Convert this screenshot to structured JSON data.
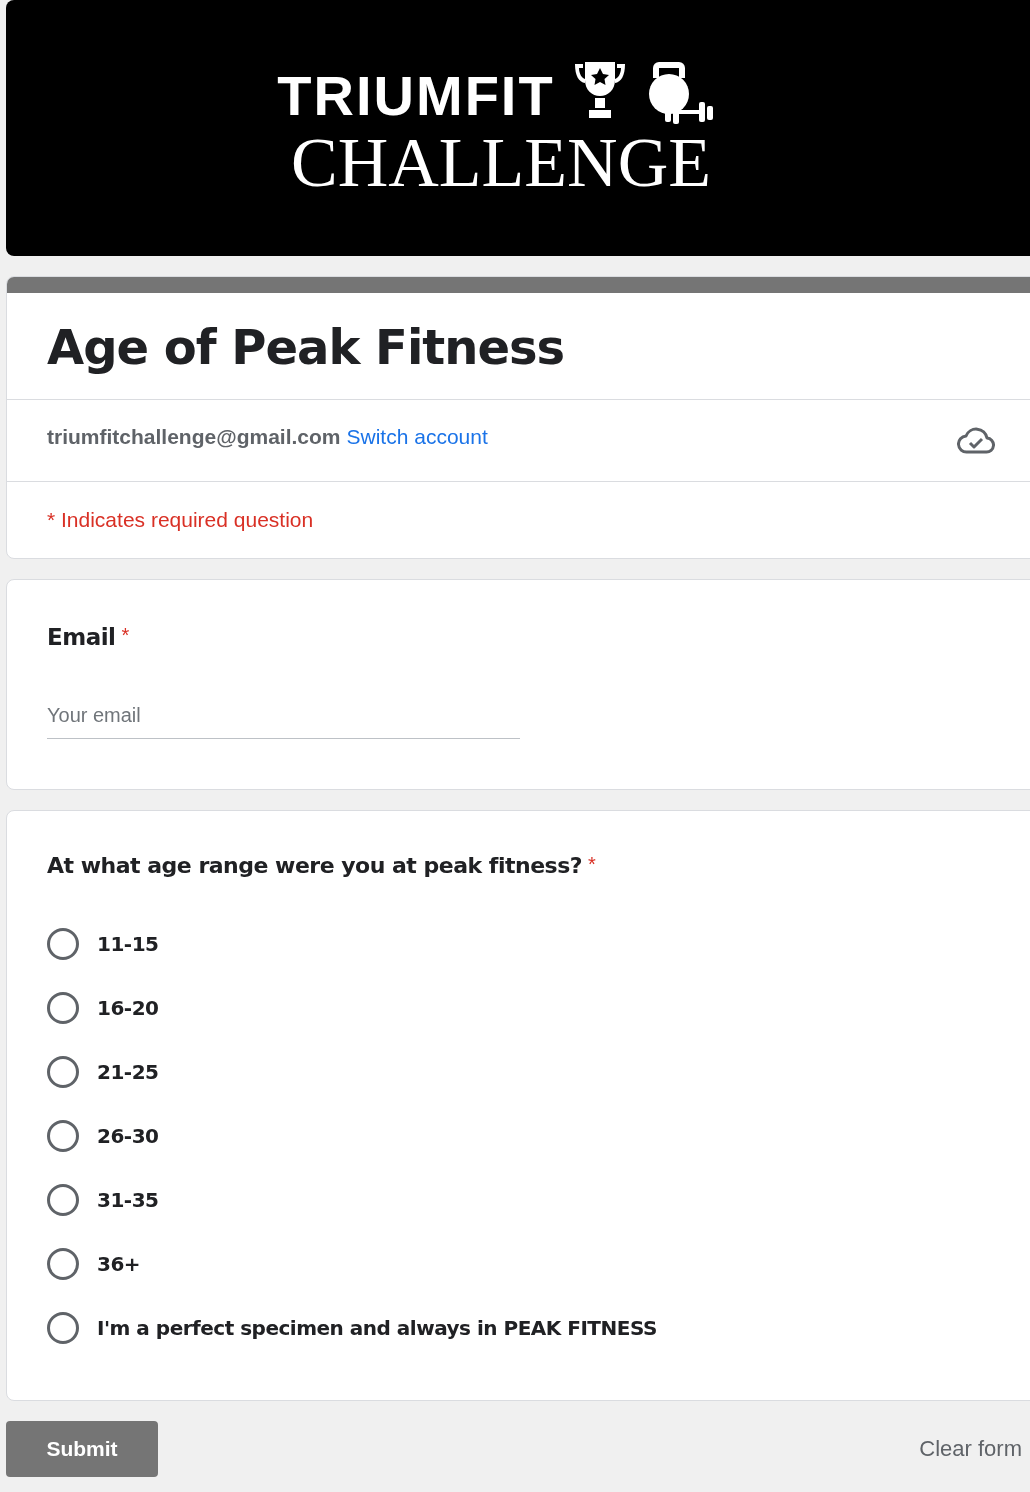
{
  "banner": {
    "line_1": "TRIUMFIT",
    "line_2": "CHALLENGE"
  },
  "form": {
    "title": "Age of Peak Fitness",
    "account": "triumfitchallenge@gmail.com",
    "switch_link": "Switch account",
    "required_note": "* Indicates required question"
  },
  "questions": [
    {
      "kind": "text",
      "label": "Email",
      "required": true,
      "required_mark": "*",
      "placeholder": "Your email"
    },
    {
      "kind": "radio",
      "label": "At what age range were you at peak fitness?",
      "required": true,
      "required_mark": "*",
      "options": [
        {
          "label": "11-15",
          "selected": false
        },
        {
          "label": "16-20",
          "selected": false
        },
        {
          "label": "21-25",
          "selected": false
        },
        {
          "label": "26-30",
          "selected": false
        },
        {
          "label": "31-35",
          "selected": false
        },
        {
          "label": "36+",
          "selected": false
        },
        {
          "label": "I'm a perfect specimen and always in PEAK FITNESS",
          "selected": false
        }
      ]
    }
  ],
  "buttons": {
    "submit": "Submit",
    "clear": "Clear form"
  }
}
